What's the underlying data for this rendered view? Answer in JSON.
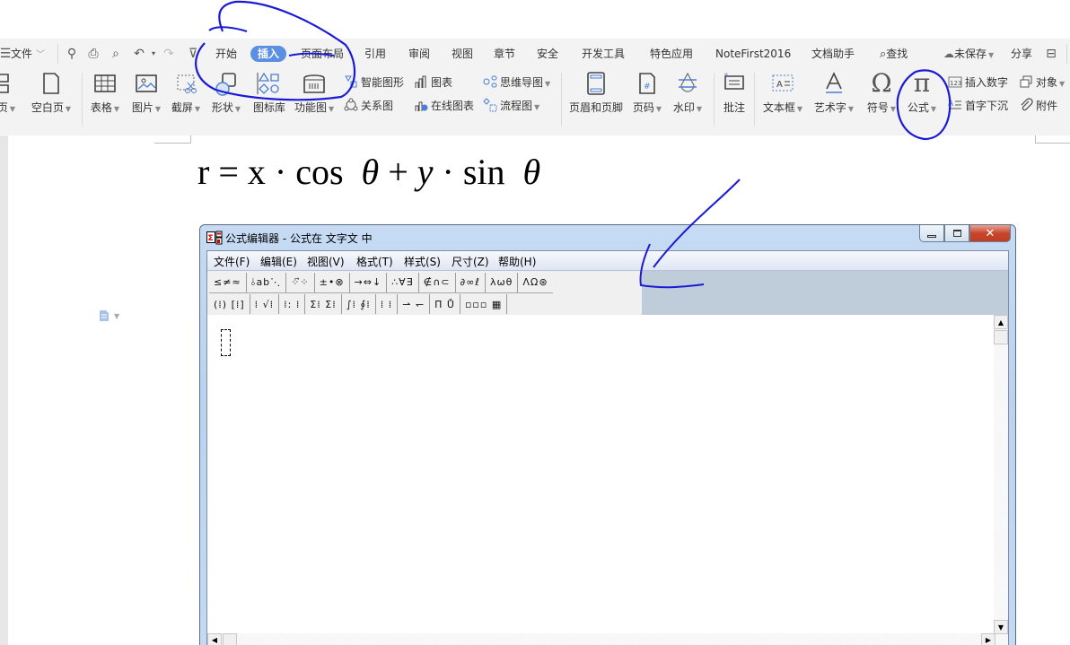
{
  "quick_access": {
    "menu_icon": "hamburger-icon",
    "file_label": "文件",
    "file_caret": "﹀",
    "icons": [
      "format-painter-icon",
      "print-icon",
      "print-preview-icon",
      "undo-icon",
      "redo-icon",
      "customize-icon"
    ]
  },
  "tabs": [
    {
      "label": "开始",
      "active": false
    },
    {
      "label": "插入",
      "active": true
    },
    {
      "label": "页面布局",
      "active": false
    },
    {
      "label": "引用",
      "active": false
    },
    {
      "label": "审阅",
      "active": false
    },
    {
      "label": "视图",
      "active": false
    },
    {
      "label": "章节",
      "active": false
    },
    {
      "label": "安全",
      "active": false
    },
    {
      "label": "开发工具",
      "active": false
    },
    {
      "label": "特色应用",
      "active": false
    },
    {
      "label": "NoteFirst2016",
      "active": false
    },
    {
      "label": "文档助手",
      "active": false
    }
  ],
  "right_tools": {
    "search_label": "查找",
    "unsaved_label": "未保存",
    "share_label": "分享"
  },
  "ribbon": {
    "large_buttons": [
      {
        "label": "页",
        "icon": "page-break-icon",
        "dropdown": true
      },
      {
        "label": "空白页",
        "icon": "blank-page-icon",
        "dropdown": true
      },
      {
        "label": "表格",
        "icon": "table-icon",
        "dropdown": true
      },
      {
        "label": "图片",
        "icon": "picture-icon",
        "dropdown": true
      },
      {
        "label": "截屏",
        "icon": "screenshot-icon",
        "dropdown": true
      },
      {
        "label": "形状",
        "icon": "shapes-icon",
        "dropdown": true
      },
      {
        "label": "图标库",
        "icon": "icon-library-icon",
        "dropdown": false
      },
      {
        "label": "功能图",
        "icon": "function-chart-icon",
        "dropdown": true
      },
      {
        "label": "页眉和页脚",
        "icon": "header-footer-icon",
        "dropdown": false
      },
      {
        "label": "页码",
        "icon": "page-number-icon",
        "dropdown": true
      },
      {
        "label": "水印",
        "icon": "watermark-icon",
        "dropdown": true
      },
      {
        "label": "批注",
        "icon": "comment-icon",
        "dropdown": false
      },
      {
        "label": "文本框",
        "icon": "textbox-icon",
        "dropdown": true
      },
      {
        "label": "艺术字",
        "icon": "wordart-icon",
        "dropdown": true
      },
      {
        "label": "符号",
        "icon": "omega-symbol-icon",
        "dropdown": true
      },
      {
        "label": "公式",
        "icon": "pi-formula-icon",
        "dropdown": true
      }
    ],
    "small_buttons": [
      {
        "label": "智能图形",
        "icon": "smartart-icon"
      },
      {
        "label": "关系图",
        "icon": "relation-chart-icon"
      },
      {
        "label": "图表",
        "icon": "bar-chart-icon"
      },
      {
        "label": "在线图表",
        "icon": "online-chart-icon"
      },
      {
        "label": "思维导图",
        "icon": "mindmap-icon",
        "dropdown": true
      },
      {
        "label": "流程图",
        "icon": "flowchart-icon",
        "dropdown": true
      },
      {
        "label": "插入数字",
        "icon": "insert-number-icon"
      },
      {
        "label": "首字下沉",
        "icon": "drop-cap-icon"
      },
      {
        "label": "对象",
        "icon": "object-icon",
        "dropdown": true
      },
      {
        "label": "附件",
        "icon": "paperclip-icon"
      }
    ]
  },
  "document": {
    "equation_parts": [
      "r",
      " = ",
      "x",
      " · cos ",
      "θ",
      " + ",
      "y",
      " · sin ",
      "θ"
    ]
  },
  "equation_editor": {
    "title": "公式编辑器 - 公式在 文字文 中",
    "menu": [
      "文件(F)",
      "编辑(E)",
      "视图(V)",
      "格式(T)",
      "样式(S)",
      "尺寸(Z)",
      "帮助(H)"
    ],
    "toolbar_row1": [
      "≤≠≈",
      "⫰ab⋱",
      "⁘⃗⁘",
      "±•⊗",
      "→⇔↓",
      "∴∀∃",
      "∉∩⊂",
      "∂∞ℓ",
      "λωθ",
      "ΛΩ⊛"
    ],
    "toolbar_row2": [
      "(⁞) [⁞]",
      "⁞ √⁞",
      "⁞: ⁞",
      "Σ⁞ Σ⁞",
      "∫⁞ ∮⁞",
      "⁞ ⁞",
      "⇀ ↽",
      "Π̄ Ů",
      "▫▫▫ ▦"
    ],
    "window_controls": {
      "minimize": "minimize-icon",
      "maximize": "maximize-icon",
      "close": "close-icon"
    }
  },
  "colors": {
    "accent": "#5a8fe2",
    "annotation_ink": "#1a1ad6",
    "close_button": "#c7452b"
  }
}
